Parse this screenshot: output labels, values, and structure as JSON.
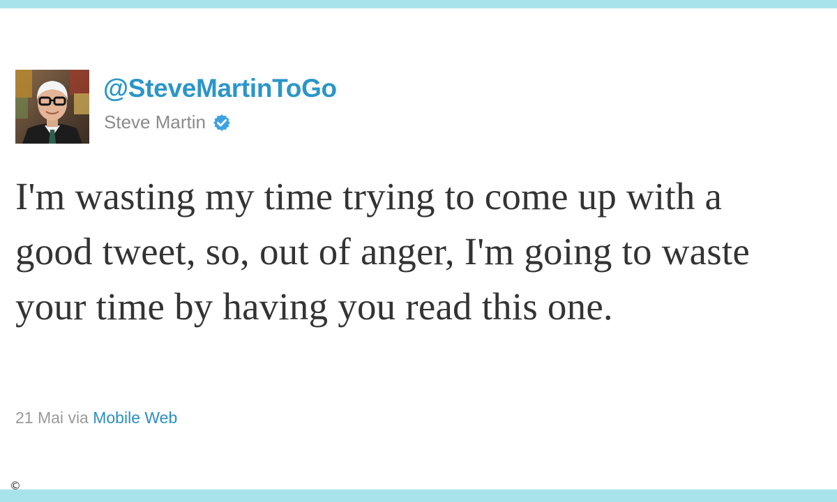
{
  "colors": {
    "accent_bar": "#a9e3ea",
    "handle": "#2b96c8",
    "link": "#2b8fc0",
    "muted_text": "#999999",
    "display_name": "#8b8b8b",
    "body_text": "#333333",
    "verified_badge": "#3ba3e3"
  },
  "tweet": {
    "handle": "@SteveMartinToGo",
    "display_name": "Steve Martin",
    "verified_icon": "verified-check-icon",
    "text": "I'm wasting my time trying to come up with a good tweet, so, out of anger, I'm going to waste your time by having you read this one.",
    "date": "21 Mai",
    "via_label": "via",
    "source": "Mobile Web"
  },
  "footer": {
    "copyright_symbol": "©"
  }
}
